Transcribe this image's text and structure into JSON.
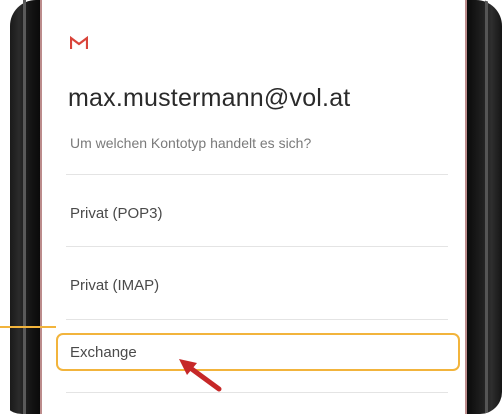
{
  "account": {
    "email": "max.mustermann@vol.at",
    "question": "Um welchen Kontotyp handelt es sich?"
  },
  "options": [
    {
      "label": "Privat (POP3)"
    },
    {
      "label": "Privat (IMAP)"
    },
    {
      "label": "Exchange"
    }
  ],
  "icons": {
    "app": "gmail-icon",
    "pointer": "red-arrow-icon"
  },
  "colors": {
    "gmail_red": "#d9443a",
    "highlight": "#f2b43c",
    "arrow": "#c62828"
  }
}
